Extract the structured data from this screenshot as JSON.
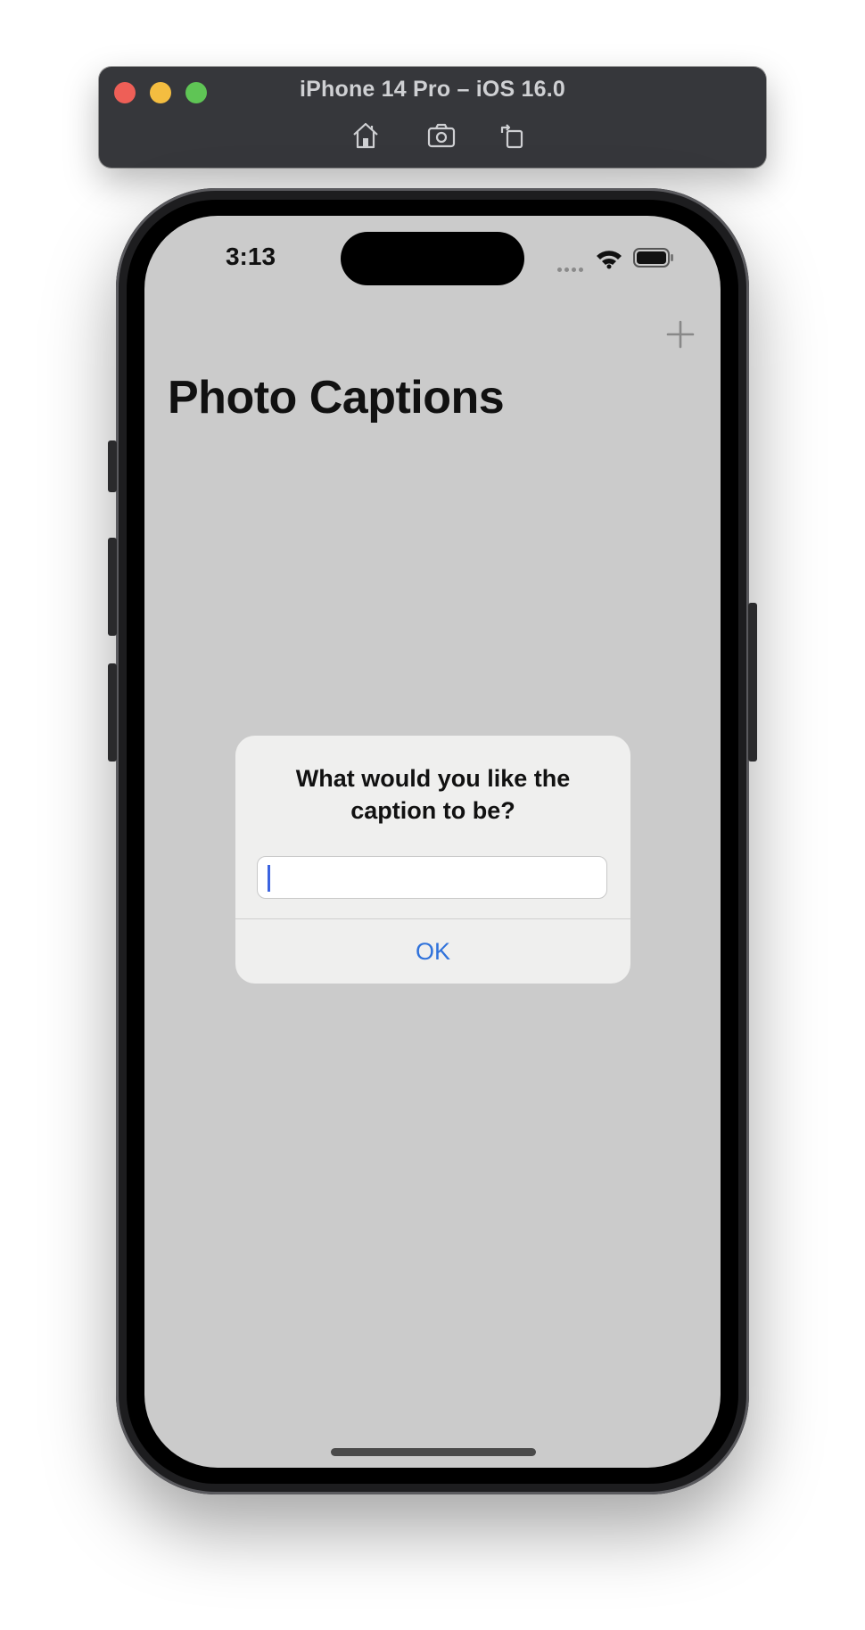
{
  "window": {
    "title": "iPhone 14 Pro – iOS 16.0",
    "toolbar_icons": [
      "home-icon",
      "screenshot-icon",
      "rotate-icon"
    ]
  },
  "status_bar": {
    "time": "3:13",
    "icons": [
      "cellular-dots-icon",
      "wifi-icon",
      "battery-icon"
    ]
  },
  "nav": {
    "title": "Photo Captions",
    "add_icon": "plus-icon"
  },
  "alert": {
    "title_line1": "What would you like the",
    "title_line2": "caption to be?",
    "field_value": "",
    "ok_label": "OK"
  },
  "colors": {
    "screen_bg": "#cbcbcb",
    "alert_bg": "#efefee",
    "tint": "#2f72db",
    "caret": "#3b63e0",
    "toolbar_bg": "#36373b"
  }
}
